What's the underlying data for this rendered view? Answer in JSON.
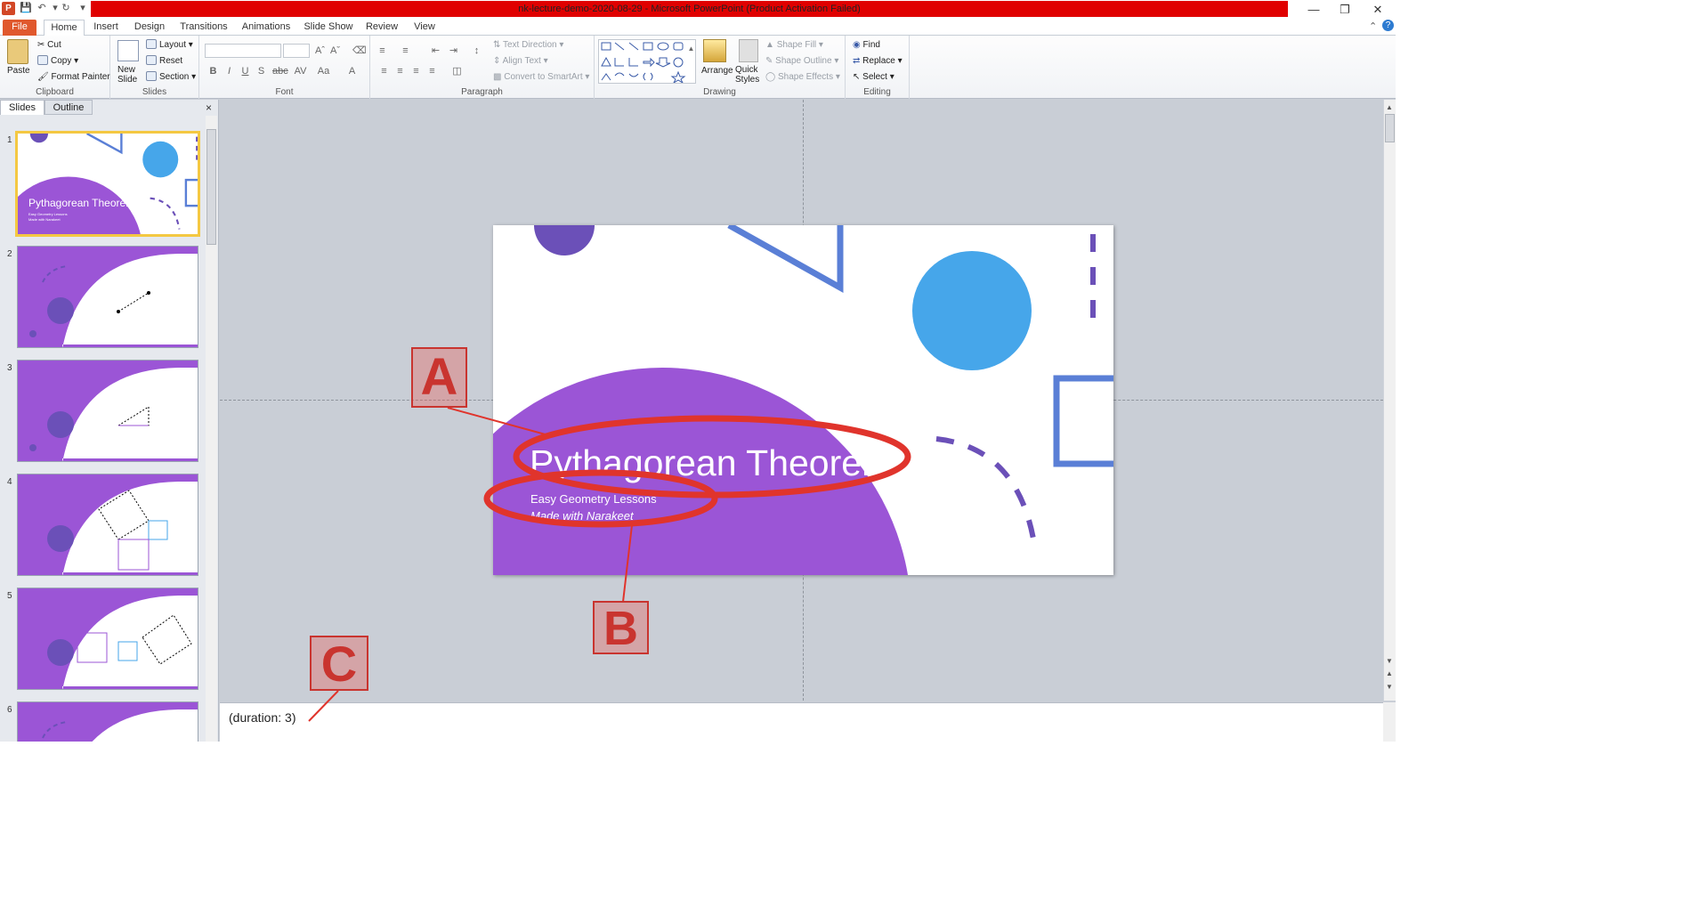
{
  "window": {
    "title": "nk-lecture-demo-2020-08-29  -  Microsoft PowerPoint (Product Activation Failed)",
    "app_icon": "powerpoint-icon"
  },
  "tabs": [
    "File",
    "Home",
    "Insert",
    "Design",
    "Transitions",
    "Animations",
    "Slide Show",
    "Review",
    "View"
  ],
  "ribbon": {
    "clipboard": {
      "label": "Clipboard",
      "paste": "Paste",
      "cut": "Cut",
      "copy": "Copy",
      "format_painter": "Format Painter"
    },
    "slides": {
      "label": "Slides",
      "new_slide": "New\nSlide",
      "layout": "Layout",
      "reset": "Reset",
      "section": "Section"
    },
    "font": {
      "label": "Font",
      "bold": "B",
      "italic": "I",
      "underline": "U",
      "strike": "S",
      "abc": "abc",
      "av": "AV",
      "aa": "Aa",
      "a_color": "A"
    },
    "paragraph": {
      "label": "Paragraph",
      "text_direction": "Text Direction",
      "align_text": "Align Text",
      "convert_smartart": "Convert to SmartArt"
    },
    "drawing": {
      "label": "Drawing",
      "arrange": "Arrange",
      "quick_styles": "Quick\nStyles",
      "shape_fill": "Shape Fill",
      "shape_outline": "Shape Outline",
      "shape_effects": "Shape Effects"
    },
    "editing": {
      "label": "Editing",
      "find": "Find",
      "replace": "Replace",
      "select": "Select"
    }
  },
  "panel": {
    "tab_slides": "Slides",
    "tab_outline": "Outline",
    "close": "×"
  },
  "thumbnails": [
    {
      "num": "1",
      "title": "Pythagorean Theorem",
      "sub1": "Easy Geometry Lessons",
      "sub2": "Made with Narakeet"
    },
    {
      "num": "2"
    },
    {
      "num": "3"
    },
    {
      "num": "4"
    },
    {
      "num": "5"
    },
    {
      "num": "6"
    }
  ],
  "slide": {
    "title": "Pythagorean Theorem",
    "subtitle": "Easy Geometry  Lessons",
    "subtitle2": "Made with Narakeet"
  },
  "notes": {
    "text": "(duration: 3)"
  },
  "annotations": {
    "a": "A",
    "b": "B",
    "c": "C"
  },
  "colors": {
    "purple": "#9b55d6",
    "blue": "#46a6ea",
    "navy": "#5a7fd6",
    "dark_purple": "#6b50b8",
    "accent_red": "#e0342c",
    "title_bar_red": "#e00000"
  }
}
